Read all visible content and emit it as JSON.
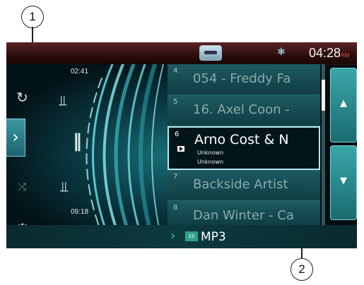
{
  "callouts": [
    "1",
    "2"
  ],
  "status_bar": {
    "time": "04:28",
    "ampm": "AM",
    "bt_icon": "bluetooth-icon",
    "phone_icon": "phone-icon"
  },
  "left_panel": {
    "elapsed": "02:41",
    "total": "09:18",
    "repeat_icon": "repeat-icon",
    "shuffle_icon": "shuffle-icon",
    "settings_icon": "gear-icon"
  },
  "tracks": [
    {
      "num": "4",
      "title": "054 - Freddy Fa"
    },
    {
      "num": "5",
      "title": "16. Axel Coon -"
    },
    {
      "num": "6",
      "title": "Arno Cost & N",
      "artist": "Unknown",
      "album": "Unknown",
      "selected": true
    },
    {
      "num": "7",
      "title": "Backside Artist"
    },
    {
      "num": "8",
      "title": "Dan Winter - Ca"
    }
  ],
  "page_buttons": {
    "up": "▲",
    "down": "▼"
  },
  "source": {
    "folder_badge": "25",
    "label": "MP3"
  }
}
